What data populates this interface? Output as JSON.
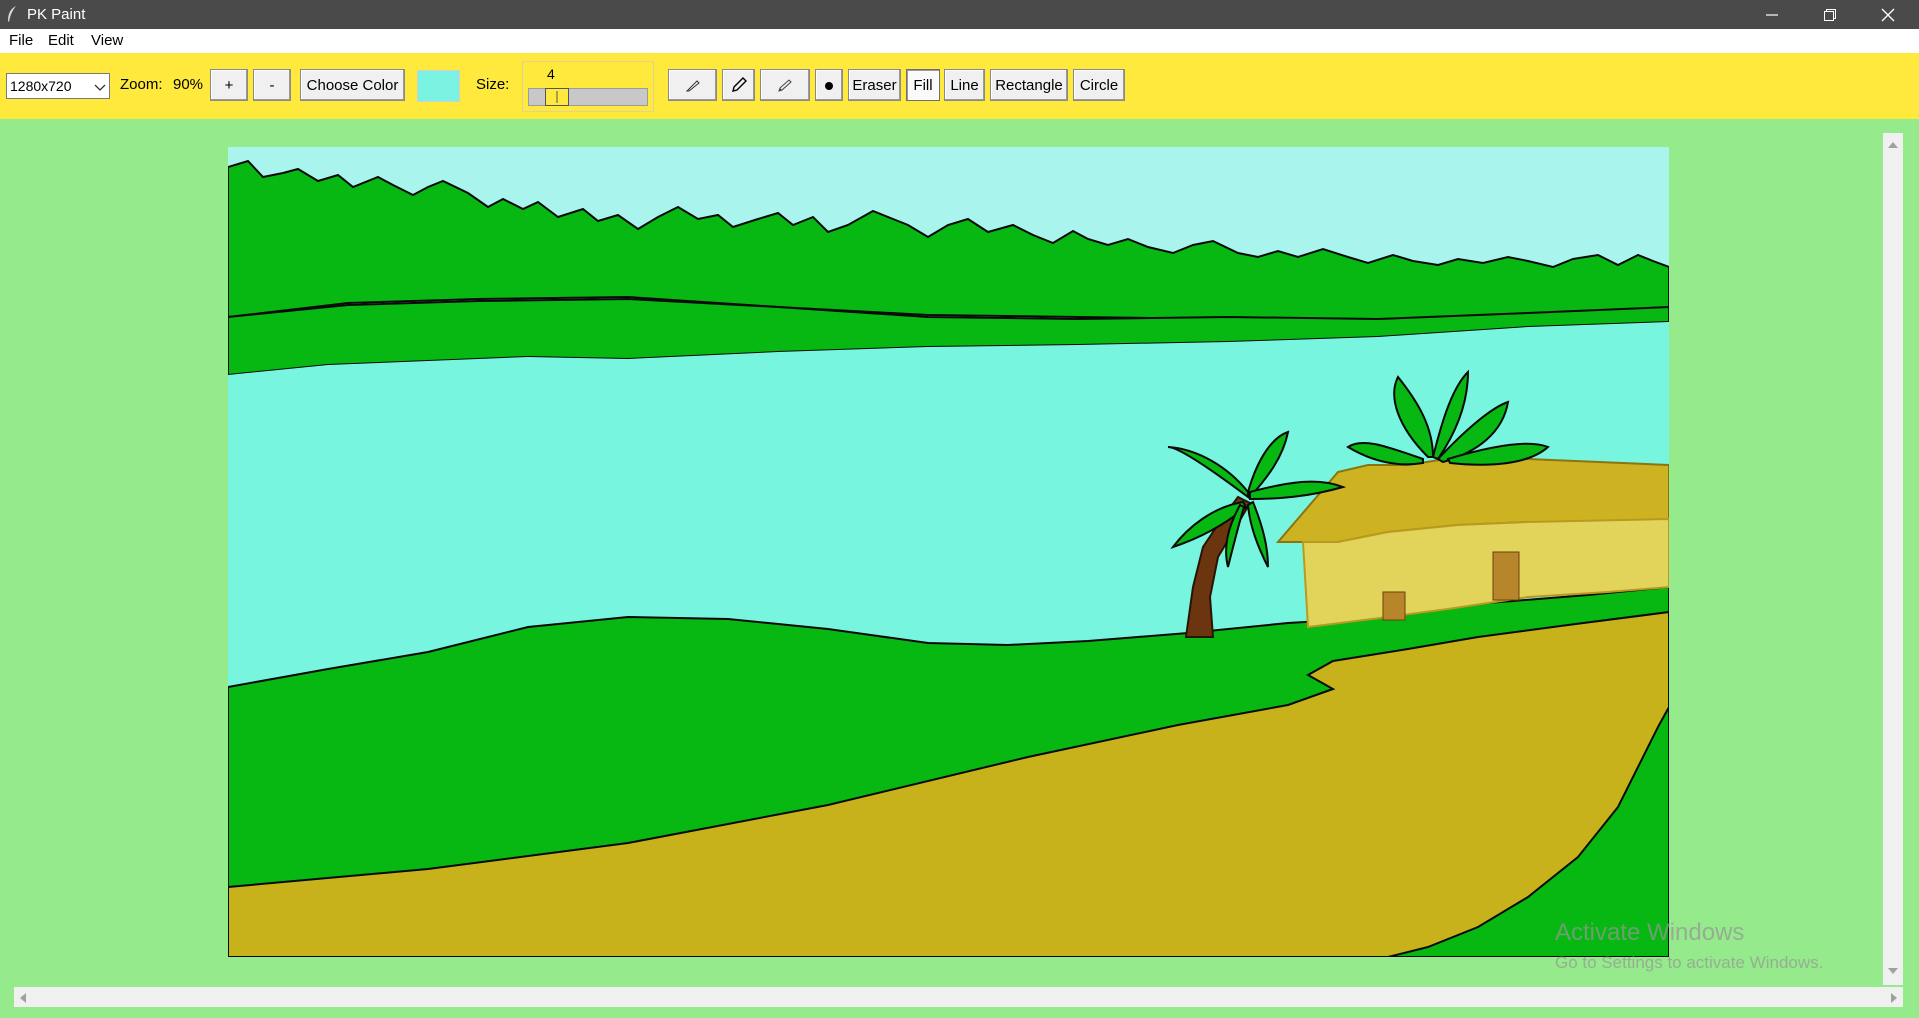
{
  "window": {
    "title": "PK Paint",
    "minimize_glyph": "─",
    "restore_glyph": "❐",
    "close_glyph": "✕"
  },
  "menubar": {
    "items": [
      {
        "label": "File"
      },
      {
        "label": "Edit"
      },
      {
        "label": "View"
      }
    ]
  },
  "toolbar": {
    "canvas_size": {
      "value": "1280x720",
      "arrow": "⌵"
    },
    "zoom": {
      "label": "Zoom:",
      "value": "90%",
      "zoom_in": "+",
      "zoom_out": "-"
    },
    "choose_color_label": "Choose Color",
    "current_color": "#7af3e3",
    "size": {
      "label": "Size:",
      "value": "4",
      "fraction": 0.17
    },
    "tools": {
      "pen_icon": "pen-icon",
      "pencil_icon": "pencil-icon",
      "brush_icon": "brush-icon",
      "dot_icon": "dot-icon",
      "eraser_label": "Eraser",
      "fill_label": "Fill",
      "line_label": "Line",
      "rectangle_label": "Rectangle",
      "circle_label": "Circle",
      "active_tool": "Fill"
    }
  },
  "colors": {
    "titlebar": "#4a4a4a",
    "toolbar": "#ffe93d",
    "workspace": "#95eb8b",
    "sky": "#a9f5ed",
    "water": "#78f5df",
    "grass": "#07b712",
    "path": "#c8b21c",
    "hut_wall": "#e2d45a",
    "hut_roof": "#cdb322",
    "trunk": "#6b3510",
    "door": "#b8862a"
  },
  "watermark": {
    "title": "Activate Windows",
    "subtitle": "Go to Settings to activate Windows."
  }
}
